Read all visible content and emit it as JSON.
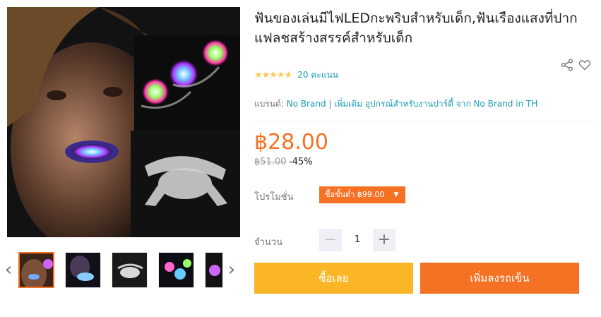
{
  "product": {
    "title": "ฟันของเล่นมีไฟLEDกะพริบสำหรับเด็ก,ฟันเรืองแสงที่ปากแฟลชสร้างสรรค์สำหรับเด็ก",
    "rating": {
      "stars": "★★★★★",
      "count_text": "20 คะแนน",
      "value": 4.5
    },
    "brand": {
      "label": "แบรนด์:",
      "name": "No Brand",
      "separator": "|",
      "more": "เพิ่มเติม อุปกรณ์สำหรับงานปาร์ตี้ จาก No Brand in TH"
    },
    "price": "฿28.00",
    "original_price": "฿51.00",
    "discount": "-45%"
  },
  "promotion": {
    "label": "โปรโมชั่น",
    "tag": "ซื้อขั้นต่ำ ฿99.00",
    "caret": "▼"
  },
  "quantity": {
    "label": "จำนวน",
    "value": "1",
    "minus": "−",
    "plus": "+"
  },
  "actions": {
    "buy_now": "ซื้อเลย",
    "add_to_cart": "เพิ่มลงรถเข็น"
  },
  "gallery": {
    "prev": "‹",
    "next": "›",
    "thumb_count": 5,
    "active_index": 0
  },
  "icons": {
    "share": "share-icon",
    "wishlist": "heart-icon"
  },
  "colors": {
    "accent": "#f57224",
    "buy": "#fbb627",
    "link": "#1a9cb7",
    "star": "#faca51"
  }
}
